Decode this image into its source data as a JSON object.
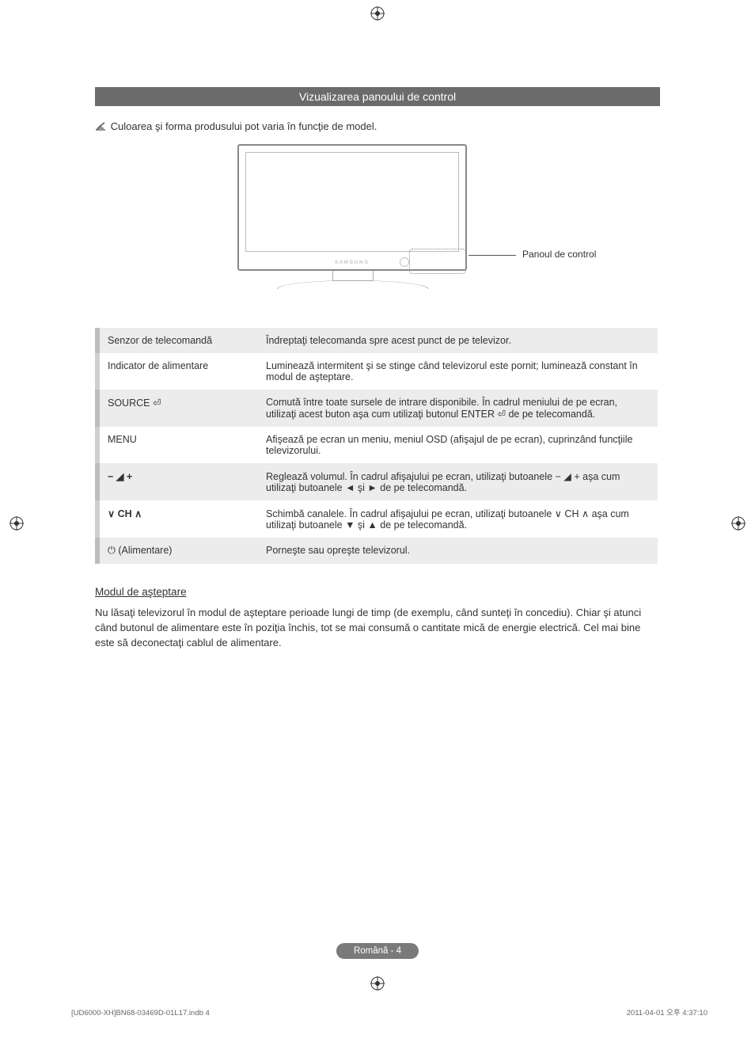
{
  "section_title": "Vizualizarea panoului de control",
  "note_text": "Culoarea şi forma produsului pot varia în funcţie de model.",
  "figure_label": "Panoul de control",
  "tv_logo": "SAMSUNG",
  "table": [
    {
      "label": "Senzor de telecomandă",
      "desc": "Îndreptaţi telecomanda spre acest punct de pe televizor."
    },
    {
      "label": "Indicator de alimentare",
      "desc": "Luminează intermitent şi se stinge când televizorul este pornit; luminează constant în modul de aşteptare."
    },
    {
      "label": "SOURCE ⏎",
      "desc": "Comută între toate sursele de intrare disponibile. În cadrul meniului de pe ecran, utilizaţi acest buton aşa cum utilizaţi butonul ENTER ⏎ de pe telecomandă."
    },
    {
      "label": "MENU",
      "desc": "Afişează pe ecran un meniu, meniul OSD (afişajul de pe ecran), cuprinzând funcţiile televizorului."
    },
    {
      "label": "− ◢ +",
      "desc": "Reglează volumul. În cadrul afişajului pe ecran, utilizaţi butoanele − ◢ + aşa cum utilizaţi butoanele ◄ şi ► de pe telecomandă."
    },
    {
      "label": "∨ CH ∧",
      "desc": "Schimbă canalele. În cadrul afişajului pe ecran, utilizaţi butoanele ∨ CH ∧ aşa cum utilizaţi butoanele ▼ şi ▲ de pe telecomandă."
    },
    {
      "label": "⏻ (Alimentare)",
      "desc": "Porneşte sau opreşte televizorul."
    }
  ],
  "standby": {
    "heading": "Modul de aşteptare",
    "body": "Nu lăsaţi televizorul în modul de aşteptare perioade lungi de timp (de exemplu, când sunteţi în concediu). Chiar şi atunci când butonul de alimentare este în poziţia închis, tot se mai consumă o cantitate mică de energie electrică. Cel mai bine este să deconectaţi cablul de alimentare."
  },
  "footer_page": "Română - 4",
  "print_meta_left": "[UD6000-XH]BN68-03469D-01L17.indb   4",
  "print_meta_right": "2011-04-01   오후 4:37:10"
}
